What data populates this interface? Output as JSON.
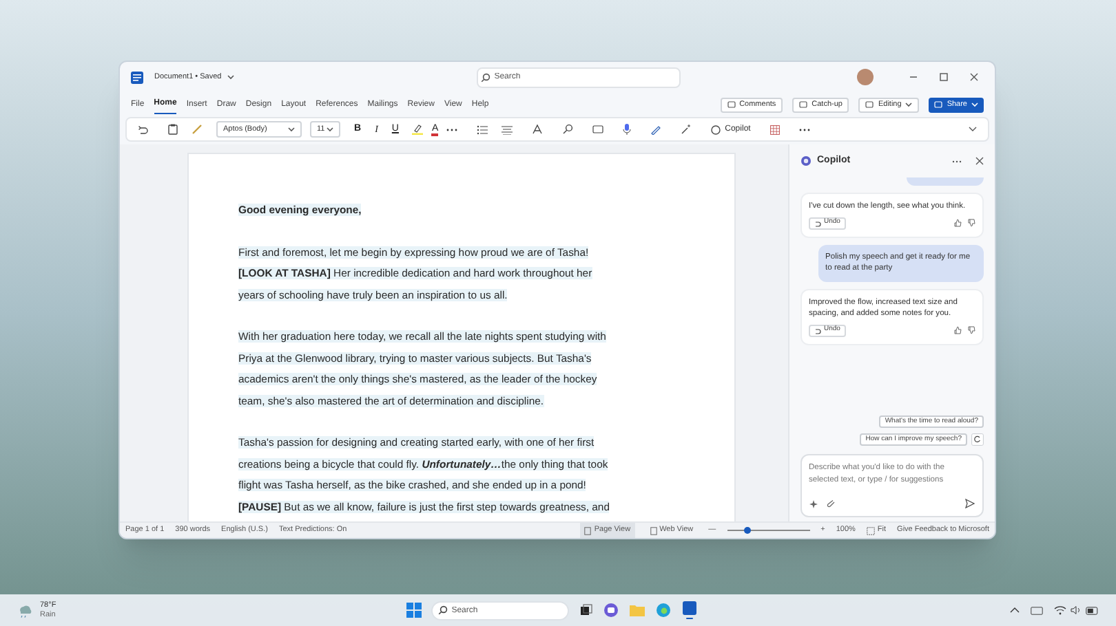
{
  "window": {
    "title": "Document1 • Saved",
    "search": {
      "placeholder": "Search"
    }
  },
  "menu": [
    {
      "label": "File",
      "selected": false
    },
    {
      "label": "Home",
      "selected": true
    },
    {
      "label": "Insert",
      "selected": false
    },
    {
      "label": "Draw",
      "selected": false
    },
    {
      "label": "Design",
      "selected": false
    },
    {
      "label": "Layout",
      "selected": false
    },
    {
      "label": "References",
      "selected": false
    },
    {
      "label": "Mailings",
      "selected": false
    },
    {
      "label": "Review",
      "selected": false
    },
    {
      "label": "View",
      "selected": false
    },
    {
      "label": "Help",
      "selected": false
    }
  ],
  "actions": [
    {
      "label": "Comments",
      "kind": "plain"
    },
    {
      "label": "Catch-up",
      "kind": "plain"
    },
    {
      "label": "Editing",
      "kind": "dropdown"
    },
    {
      "label": "Share",
      "kind": "primary"
    }
  ],
  "toolbar": {
    "font": "Aptos (Body)",
    "size": "11",
    "bold": "B",
    "italic": "I",
    "underline": "U",
    "font_color": "A",
    "copilot": "Copilot"
  },
  "document": {
    "paragraphs": [
      [
        {
          "kind": "bold",
          "text": "Good evening everyone,"
        }
      ],
      [
        {
          "kind": "plain",
          "text": "First and foremost, let me begin by expressing how proud we are of Tasha! "
        },
        {
          "kind": "bold",
          "text": "[LOOK AT TASHA]"
        },
        {
          "kind": "plain",
          "text": " Her incredible dedication and hard work throughout her years of schooling have truly been an inspiration to us all."
        }
      ],
      [
        {
          "kind": "plain",
          "text": "With her graduation here today, we recall all the late nights spent studying with Priya at the Glenwood library, trying to master various subjects. But Tasha's academics aren't the only things she's mastered, as the leader of the hockey team, she's also mastered the art of determination and discipline."
        }
      ],
      [
        {
          "kind": "plain",
          "text": "Tasha's passion for designing and creating started early, with one of her first creations being a bicycle that could fly. "
        },
        {
          "kind": "bold_italic",
          "text": "Unfortunately…"
        },
        {
          "kind": "plain",
          "text": "the only thing that took flight was Tasha herself, as the bike crashed, and she ended up in a pond! "
        },
        {
          "kind": "bold",
          "text": "[PAUSE]"
        },
        {
          "kind": "plain",
          "text": " But as we all know, failure is just the first step towards greatness, and"
        }
      ]
    ]
  },
  "copilot": {
    "title": "Copilot",
    "messages": [
      {
        "kind": "assistant",
        "text": "I've cut down the length, see what you think.",
        "undo": "Undo"
      },
      {
        "kind": "user",
        "text": "Polish my speech and get it ready for me to read at the party"
      },
      {
        "kind": "assistant",
        "text": "Improved the flow, increased text size and spacing, and added some notes for you.",
        "undo": "Undo"
      }
    ],
    "suggestions": [
      "What's the time to read aloud?",
      "How can I improve my speech?"
    ],
    "input": {
      "placeholder": "Describe what you'd like to do with the selected text, or type / for suggestions"
    }
  },
  "status_bar": {
    "page": "Page 1 of 1",
    "words": "390 words",
    "language": "English (U.S.)",
    "predictions": "Text Predictions: On",
    "views": [
      {
        "label": "Page View",
        "selected": true
      },
      {
        "label": "Web View",
        "selected": false
      }
    ],
    "zoom_minus": "—",
    "zoom_plus": "+",
    "zoom": {
      "level": 0.25
    },
    "zoom_percent": "100%",
    "fit": "Fit",
    "feedback": "Give Feedback to Microsoft"
  },
  "taskbar": {
    "temperature": "78°F",
    "weather": "Rain",
    "search": {
      "placeholder": "Search"
    }
  }
}
